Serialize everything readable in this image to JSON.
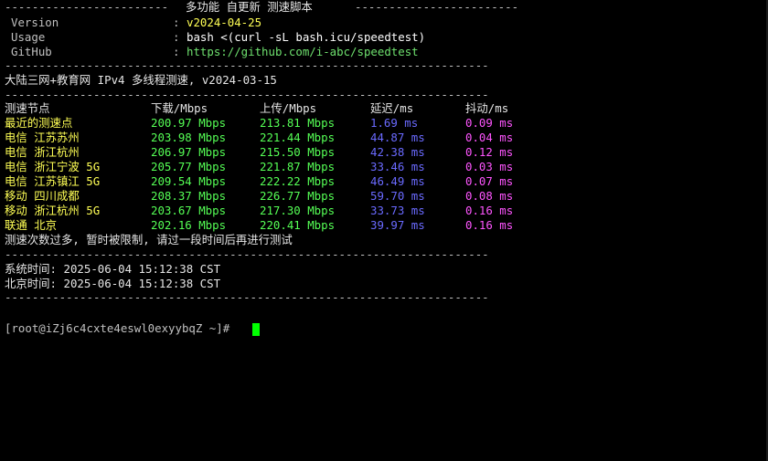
{
  "terminal": {
    "header_sep_left": "------------------------",
    "header_title": "多功能 自更新 测速脚本",
    "header_sep_right": "------------------------",
    "info": [
      {
        "label": "Version",
        "colon": ":",
        "value": "v2024-04-25"
      },
      {
        "label": "Usage",
        "colon": ":",
        "value": "bash <(curl -sL bash.icu/speedtest)"
      },
      {
        "label": "GitHub",
        "colon": ":",
        "value": "https://github.com/i-abc/speedtest"
      }
    ],
    "divider": "-----------------------------------------------------------------------",
    "mode_line": "大陆三网+教育网 IPv4 多线程测速, v2024-03-15",
    "columns": {
      "node": "测速节点",
      "download": "下载/Mbps",
      "upload": "上传/Mbps",
      "latency": "延迟/ms",
      "jitter": "抖动/ms"
    },
    "rows": [
      {
        "node": "最近的测速点",
        "download": "200.97 Mbps",
        "upload": "213.81 Mbps",
        "latency": "1.69 ms",
        "jitter": "0.09 ms"
      },
      {
        "node": "电信 江苏苏州",
        "download": "203.98 Mbps",
        "upload": "221.44 Mbps",
        "latency": "44.87 ms",
        "jitter": "0.04 ms"
      },
      {
        "node": "电信 浙江杭州",
        "download": "206.97 Mbps",
        "upload": "215.50 Mbps",
        "latency": "42.38 ms",
        "jitter": "0.12 ms"
      },
      {
        "node": "电信 浙江宁波 5G",
        "download": "205.77 Mbps",
        "upload": "221.87 Mbps",
        "latency": "33.46 ms",
        "jitter": "0.03 ms"
      },
      {
        "node": "电信 江苏镇江 5G",
        "download": "209.54 Mbps",
        "upload": "222.22 Mbps",
        "latency": "46.49 ms",
        "jitter": "0.07 ms"
      },
      {
        "node": "移动 四川成都",
        "download": "208.37 Mbps",
        "upload": "226.77 Mbps",
        "latency": "59.70 ms",
        "jitter": "0.08 ms"
      },
      {
        "node": "移动 浙江杭州 5G",
        "download": "203.67 Mbps",
        "upload": "217.30 Mbps",
        "latency": "33.73 ms",
        "jitter": "0.16 ms"
      },
      {
        "node": "联通 北京",
        "download": "202.16 Mbps",
        "upload": "220.41 Mbps",
        "latency": "39.97 ms",
        "jitter": "0.16 ms"
      }
    ],
    "notice": "测速次数过多, 暂时被限制, 请过一段时间后再进行测试",
    "system_time": "系统时间: 2025-06-04 15:12:38 CST",
    "beijing_time": "北京时间: 2025-06-04 15:12:38 CST",
    "prompt": "[root@iZj6c4cxte4eswl0exyybqZ ~]#"
  },
  "colors": {
    "background": "#000000",
    "label_yellow": "#ffff55",
    "value_green": "#55ff55",
    "latency_blue": "#6a6aff",
    "jitter_magenta": "#ff55ff",
    "cursor": "#00ff00"
  }
}
